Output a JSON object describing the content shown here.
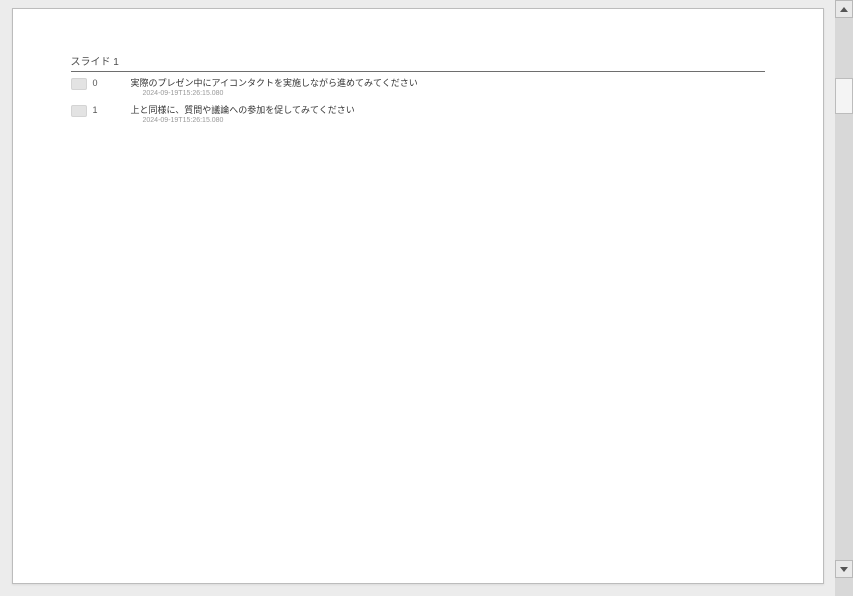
{
  "slide": {
    "heading": "スライド 1"
  },
  "comments": [
    {
      "index": "0",
      "text": "実際のプレゼン中にアイコンタクトを実施しながら進めてみてください",
      "meta": "2024-09-19T15:26:15.080"
    },
    {
      "index": "1",
      "text": "上と同様に、質問や議論への参加を促してみてください",
      "meta": "2024-09-19T15:26:15.080"
    }
  ]
}
